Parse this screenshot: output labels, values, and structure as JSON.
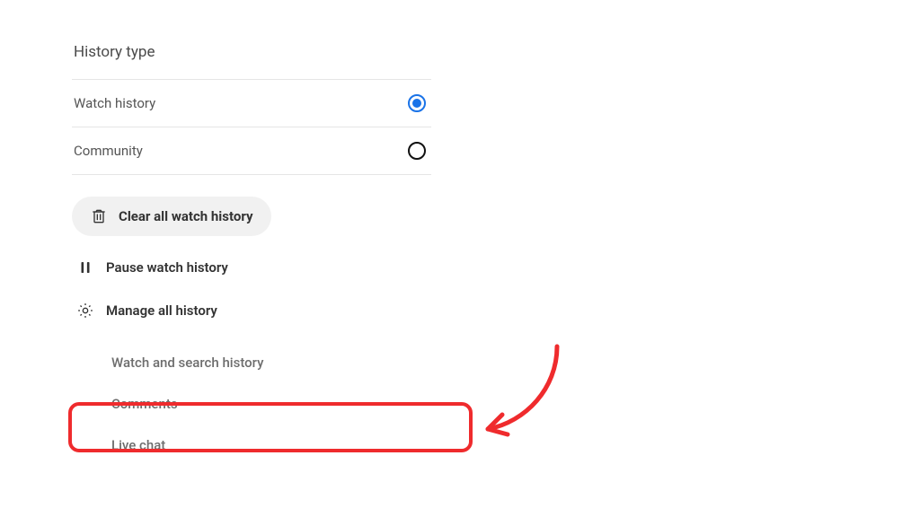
{
  "heading": "History type",
  "options": {
    "watch_history": "Watch history",
    "community": "Community"
  },
  "selected_option": "watch_history",
  "actions": {
    "clear": "Clear all watch history",
    "pause": "Pause watch history",
    "manage": "Manage all history"
  },
  "manage_items": {
    "watch_search": "Watch and search history",
    "comments": "Comments",
    "live_chat": "Live chat"
  },
  "annotation": {
    "highlight_target": "comments",
    "color": "#ef2b2d"
  }
}
